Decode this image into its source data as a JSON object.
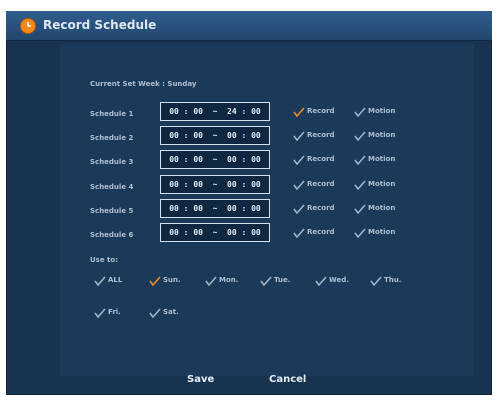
{
  "window": {
    "title": "Record Schedule",
    "icon": "clock-icon"
  },
  "current_week": "Current Set Week : Sunday",
  "schedules": [
    {
      "label": "Schedule 1",
      "time": "00 : 00  ~  24 : 00",
      "record": "Record",
      "motion": "Motion",
      "record_checked": true
    },
    {
      "label": "Schedule 2",
      "time": "00 : 00  ~  00 : 00",
      "record": "Record",
      "motion": "Motion",
      "record_checked": false
    },
    {
      "label": "Schedule 3",
      "time": "00 : 00  ~  00 : 00",
      "record": "Record",
      "motion": "Motion",
      "record_checked": false
    },
    {
      "label": "Schedule 4",
      "time": "00 : 00  ~  00 : 00",
      "record": "Record",
      "motion": "Motion",
      "record_checked": false
    },
    {
      "label": "Schedule 5",
      "time": "00 : 00  ~  00 : 00",
      "record": "Record",
      "motion": "Motion",
      "record_checked": false
    },
    {
      "label": "Schedule 6",
      "time": "00 : 00  ~  00 : 00",
      "record": "Record",
      "motion": "Motion",
      "record_checked": false
    }
  ],
  "use_to": {
    "label": "Use to:",
    "days": [
      {
        "label": "ALL",
        "checked": false
      },
      {
        "label": "Sun.",
        "checked": true
      },
      {
        "label": "Mon.",
        "checked": false
      },
      {
        "label": "Tue.",
        "checked": false
      },
      {
        "label": "Wed.",
        "checked": false
      },
      {
        "label": "Thu.",
        "checked": false
      },
      {
        "label": "Fri.",
        "checked": false
      },
      {
        "label": "Sat.",
        "checked": false
      }
    ]
  },
  "buttons": {
    "save": "Save",
    "cancel": "Cancel"
  },
  "colors": {
    "checked": "#f08a1f",
    "unchecked": "#9fb3c8",
    "background": "#173350"
  }
}
